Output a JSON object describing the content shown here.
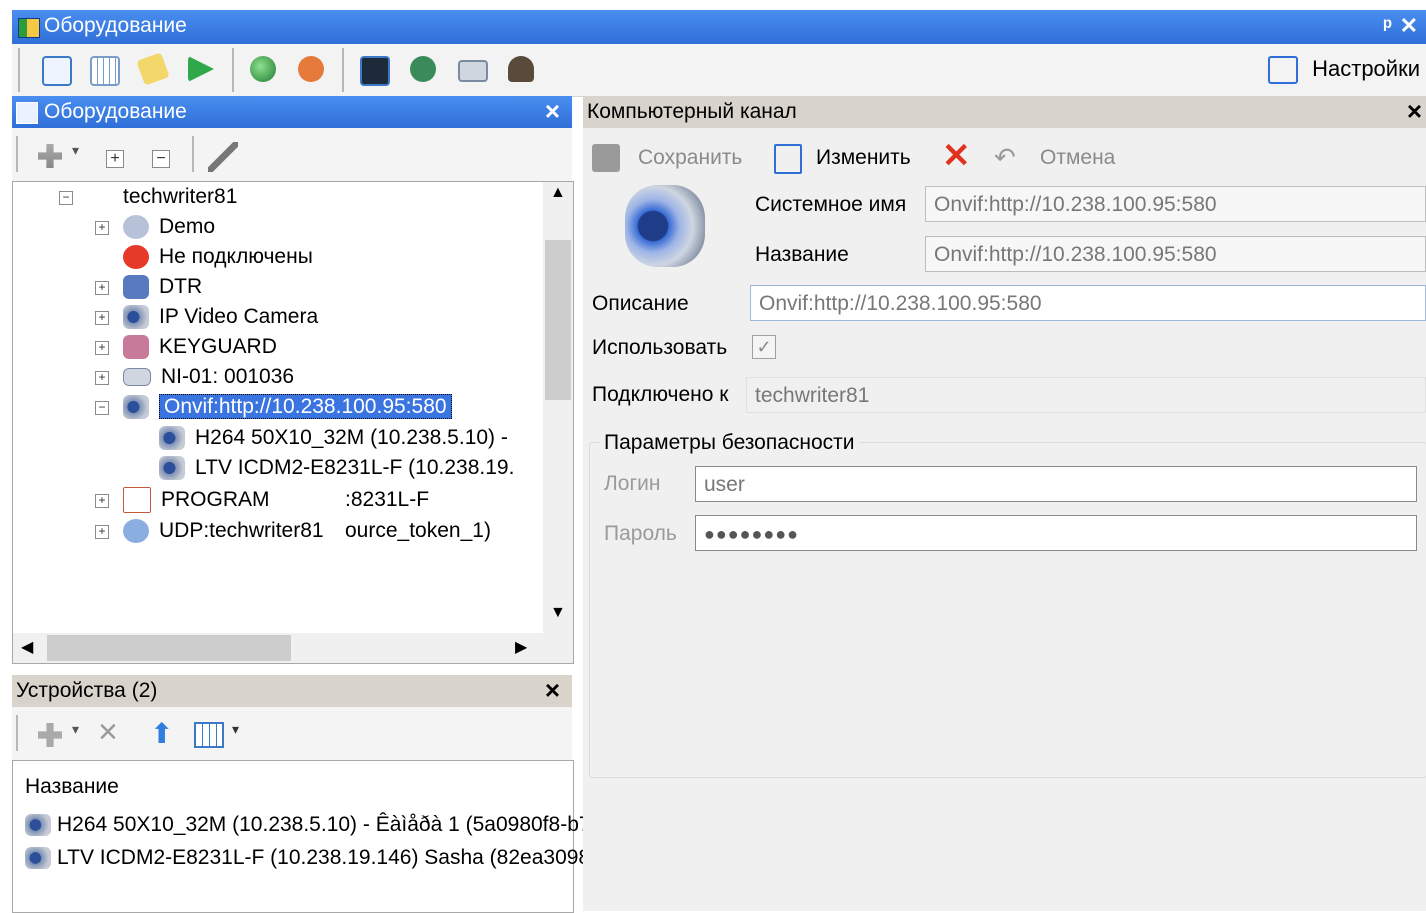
{
  "window": {
    "title": "Оборудование"
  },
  "toolbar": {
    "settings_label": "Настройки"
  },
  "tree_panel": {
    "title": "Оборудование",
    "nodes": [
      {
        "label": "techwriter81"
      },
      {
        "label": "Demo"
      },
      {
        "label": "Не подключены"
      },
      {
        "label": "DTR"
      },
      {
        "label": "IP Video Camera"
      },
      {
        "label": "KEYGUARD"
      },
      {
        "label": "NI-01: 001036"
      },
      {
        "label": "Onvif:http://10.238.100.95:580"
      },
      {
        "label": "H264 50X10_32M (10.238.5.10) -"
      },
      {
        "label": "LTV ICDM2-E8231L-F (10.238.19."
      },
      {
        "label": "PROGRAM"
      },
      {
        "label": "UDP:techwriter81"
      }
    ],
    "overflow_text_1": ":8231L-F",
    "overflow_text_2": "ource_token_1)"
  },
  "devices_panel": {
    "title": "Устройства (2)",
    "column_header": "Название",
    "rows": [
      "H264 50X10_32M (10.238.5.10) - Êàìåðà 1 (5a0980f8-b7",
      "LTV ICDM2-E8231L-F (10.238.19.146) Sasha (82ea3098"
    ]
  },
  "details_panel": {
    "title": "Компьютерный канал",
    "save_label": "Сохранить",
    "edit_label": "Изменить",
    "cancel_label": "Отмена",
    "system_name_label": "Системное имя",
    "system_name_value": "Onvif:http://10.238.100.95:580",
    "name_label": "Название",
    "name_value": "Onvif:http://10.238.100.95:580",
    "description_label": "Описание",
    "description_value": "Onvif:http://10.238.100.95:580",
    "use_label": "Использовать",
    "connected_label": "Подключено к",
    "connected_value": "techwriter81",
    "security_group": "Параметры безопасности",
    "login_label": "Логин",
    "login_value": "user",
    "password_label": "Пароль",
    "password_value": "●●●●●●●●"
  }
}
